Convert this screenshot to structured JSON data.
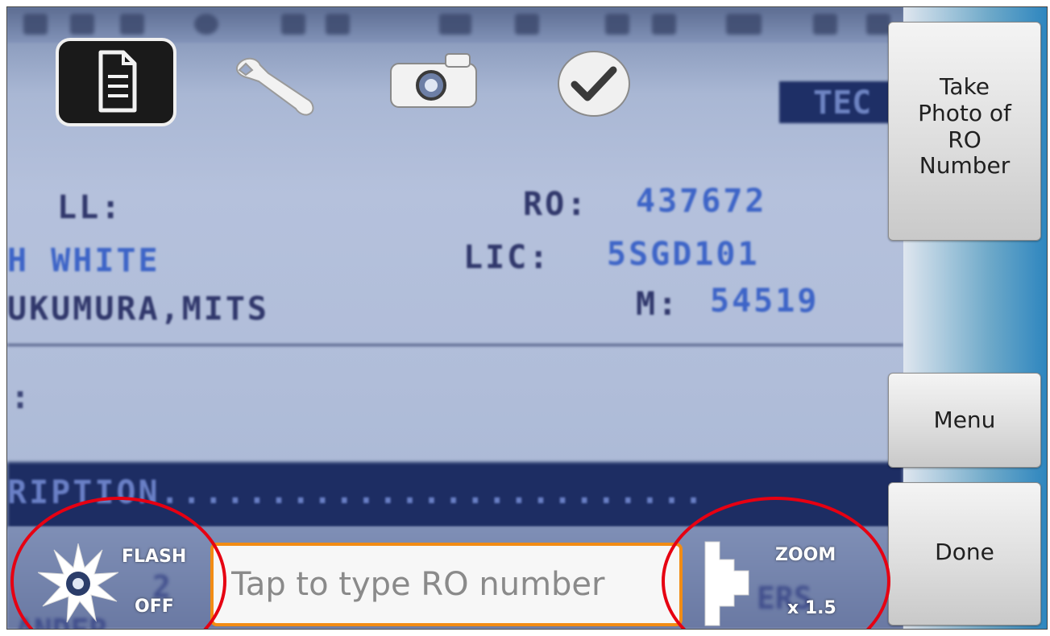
{
  "viewfinder": {
    "header_text": "TEC",
    "call_label": "LL:",
    "ro_label": "RO:",
    "ro_value": "437672",
    "color_value": "H WHITE",
    "lic_label": "LIC:",
    "lic_value": "5SGD101",
    "name_value": "UKUMURA,MITS",
    "mileage_label": "M:",
    "mileage_value": "54519",
    "colon_text": ":",
    "description_text": "RIPTION.........................",
    "year_partial": "2",
    "ers_partial": "ERS",
    "bottom_partial": "ANDER"
  },
  "modes": {
    "document": "document-icon",
    "tools": "wrench-icon",
    "camera": "camera-icon",
    "complete": "checkmark-icon"
  },
  "buttons": {
    "take_photo": "Take\nPhoto of\nRO\nNumber",
    "menu": "Menu",
    "done": "Done"
  },
  "flash": {
    "title": "FLASH",
    "state": "OFF"
  },
  "ro_input": {
    "placeholder": "Tap to type RO number",
    "value": ""
  },
  "zoom": {
    "title": "ZOOM",
    "level": "x 1.5"
  },
  "colors": {
    "input_border": "#f28c14",
    "annotation_circle": "#e60012",
    "screen_blue": "#3d64c7"
  }
}
